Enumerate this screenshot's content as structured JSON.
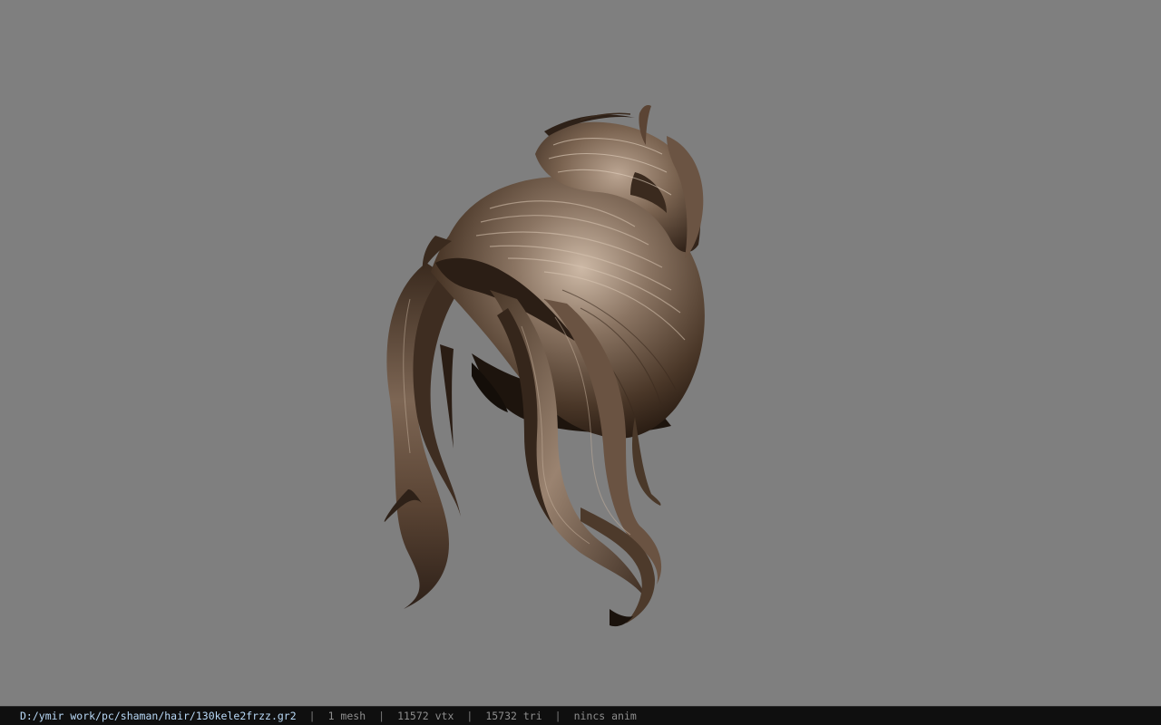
{
  "viewport": {
    "background_color": "#7f7f7f",
    "model_name": "hair-mesh",
    "hair_colors": {
      "dark": "#2a1d14",
      "mid": "#5a4636",
      "light": "#a08a76",
      "highlight": "#cdb9a6"
    }
  },
  "statusbar": {
    "file_path": "D:/ymir work/pc/shaman/hair/130kele2frzz.gr2",
    "separator": "|",
    "mesh_count": "1 mesh",
    "vertex_count": "11572 vtx",
    "triangle_count": "15732 tri",
    "animation": "nincs anim"
  }
}
